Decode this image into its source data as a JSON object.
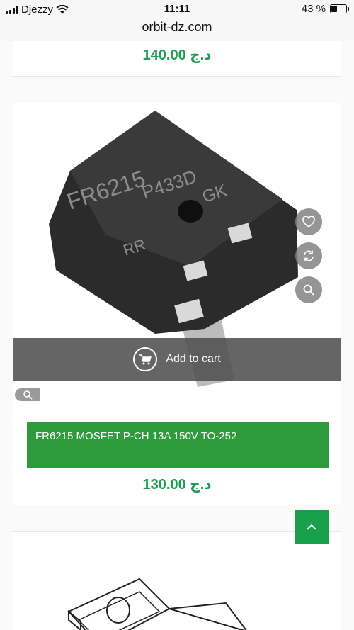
{
  "status_bar": {
    "carrier": "Djezzy",
    "time": "11:11",
    "battery": "43 %",
    "battery_level": 0.43
  },
  "browser": {
    "url": "orbit-dz.com"
  },
  "products": [
    {
      "price": "140.00 د.ج"
    },
    {
      "name": "FR6215 MOSFET P-CH 13A 150V TO-252",
      "price": "130.00 د.ج",
      "image_text": {
        "line1": "FR6215",
        "line2": "P433D",
        "line3": "GK",
        "line4": "RR"
      },
      "add_to_cart_label": "Add to cart"
    }
  ],
  "icons": {
    "wishlist": "heart-icon",
    "compare": "refresh-icon",
    "quick_view": "search-icon",
    "cart": "cart-icon",
    "back_to_top": "chevron-up-icon"
  },
  "colors": {
    "price": "#1f9d55",
    "title_bar": "#2e9b3a",
    "back_to_top": "#18a04a"
  }
}
